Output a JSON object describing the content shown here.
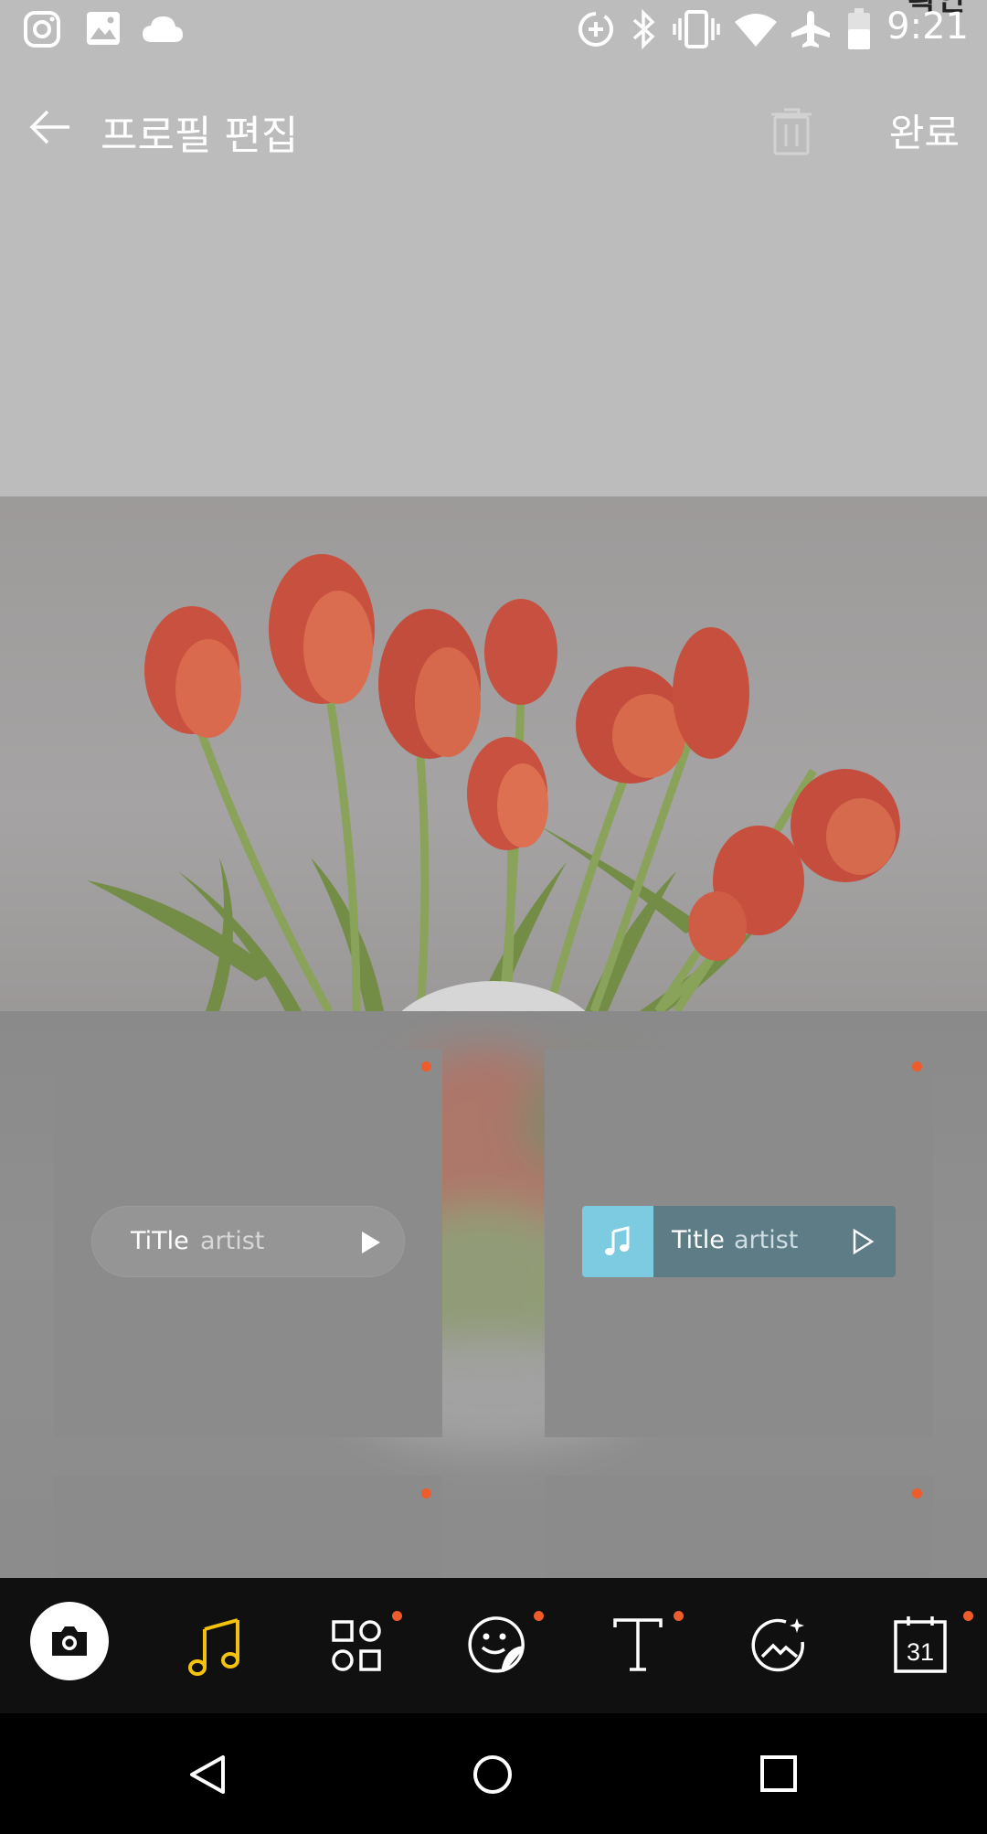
{
  "status_bar": {
    "time": "9:21",
    "hidden_text": "확인",
    "left_icons": [
      "instagram-icon",
      "gallery-icon",
      "cloud-icon"
    ],
    "right_icons": [
      "data-saver-icon",
      "bluetooth-icon",
      "vibrate-icon",
      "wifi-icon",
      "airplane-icon",
      "battery-icon"
    ]
  },
  "header": {
    "back_icon": "back-arrow-icon",
    "title": "프로필 편집",
    "delete_icon": "trash-icon",
    "done_label": "완료"
  },
  "music_cards": [
    {
      "title": "TiTle",
      "artist": "artist",
      "style": "pill",
      "play_icon": "play-icon",
      "new_dot": true
    },
    {
      "title": "Title",
      "artist": "artist",
      "style": "bar",
      "note_icon": "music-note-icon",
      "play_icon": "play-outline-icon",
      "new_dot": true
    },
    {
      "title": "",
      "artist": "",
      "new_dot": true
    },
    {
      "title": "",
      "artist": "",
      "new_dot": true
    }
  ],
  "toolbar": {
    "items": [
      {
        "name": "camera",
        "icon": "camera-icon",
        "active": true,
        "new_dot": false
      },
      {
        "name": "music",
        "icon": "music-note-icon",
        "selected": true,
        "new_dot": false
      },
      {
        "name": "widgets",
        "icon": "widgets-icon",
        "new_dot": true
      },
      {
        "name": "sticker",
        "icon": "sticker-icon",
        "new_dot": true
      },
      {
        "name": "text",
        "icon": "text-icon",
        "new_dot": true
      },
      {
        "name": "background",
        "icon": "background-icon",
        "new_dot": false
      },
      {
        "name": "calendar",
        "icon": "calendar-icon",
        "label": "31",
        "new_dot": true
      }
    ]
  },
  "nav_bar": {
    "buttons": [
      "back-triangle-icon",
      "home-circle-icon",
      "recents-square-icon"
    ]
  },
  "colors": {
    "accent_dot": "#ef5c2c",
    "music_yellow": "#f2c20c",
    "music_bar_teal": "#7ccbe0"
  }
}
